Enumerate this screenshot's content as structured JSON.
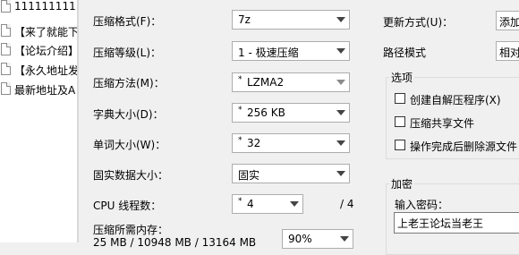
{
  "file_list": [
    "1111111111",
    "【来了就能下",
    "【论坛介绍】",
    "【永久地址发",
    "最新地址及A"
  ],
  "settings": {
    "format_label": "压缩格式(F)：",
    "format_value": "7z",
    "level_label": "压缩等级(L)：",
    "level_value": "1 - 极速压缩",
    "method_label": "压缩方法(M)：",
    "method_value": "LZMA2",
    "dict_label": "字典大小(D)：",
    "dict_value": "256 KB",
    "word_label": "单词大小(W)：",
    "word_value": "32",
    "solid_label": "固实数据大小：",
    "solid_value": "固实",
    "cpu_label": "CPU 线程数：",
    "cpu_value": "4",
    "cpu_max": "/ 4",
    "memory_label": "压缩所需内存：",
    "memory_values": "25 MB / 10948 MB / 13164 MB",
    "memory_percent": "90%"
  },
  "right": {
    "update_label": "更新方式(U)：",
    "update_value": "添加",
    "path_label": "路径模式",
    "path_value": "相对",
    "options_title": "选项",
    "options": [
      "创建自解压程序(X)",
      "压缩共享文件",
      "操作完成后删除源文件"
    ],
    "encryption_title": "加密",
    "password_label": "输入密码：",
    "password_value": "上老王论坛当老王"
  },
  "icons": {
    "file_icon": "document-icon",
    "dropdown_icon": "chevron-down-icon"
  }
}
